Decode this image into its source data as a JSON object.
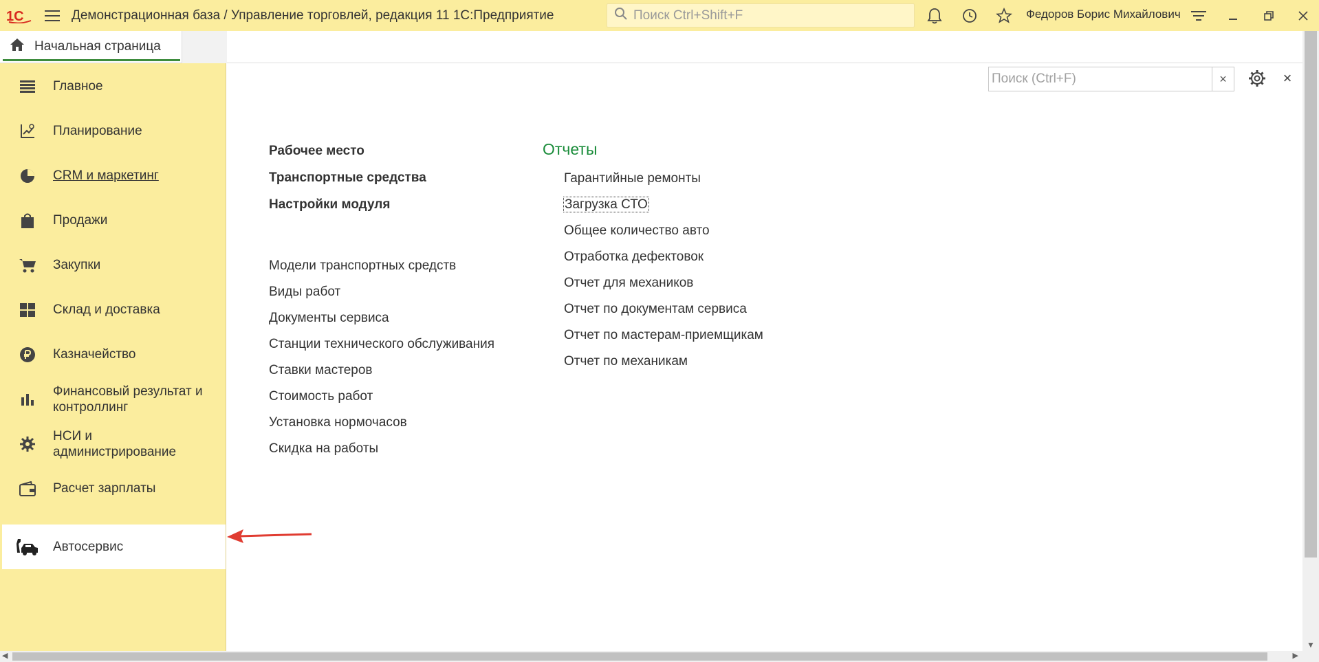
{
  "titlebar": {
    "app_title": "Демонстрационная база / Управление торговлей, редакция 11 1С:Предприятие",
    "search_placeholder": "Поиск Ctrl+Shift+F",
    "user_name": "Федоров Борис Михайлович"
  },
  "tabs": {
    "home_label": "Начальная страница"
  },
  "sidebar": {
    "items": [
      {
        "label": "Главное",
        "icon": "list-icon"
      },
      {
        "label": "Планирование",
        "icon": "planning-chart-icon"
      },
      {
        "label": "CRM и маркетинг",
        "icon": "pie-chart-icon"
      },
      {
        "label": "Продажи",
        "icon": "shopping-bag-icon"
      },
      {
        "label": "Закупки",
        "icon": "cart-icon"
      },
      {
        "label": "Склад и доставка",
        "icon": "warehouse-grid-icon"
      },
      {
        "label": "Казначейство",
        "icon": "ruble-coin-icon"
      },
      {
        "label": "Финансовый результат и контроллинг",
        "icon": "bar-chart-icon"
      },
      {
        "label": "НСИ и администрирование",
        "icon": "gear-icon"
      },
      {
        "label": "Расчет зарплаты",
        "icon": "wallet-icon"
      },
      {
        "label": "Автосервис",
        "icon": "car-service-icon"
      }
    ]
  },
  "panel": {
    "search_placeholder": "Поиск (Ctrl+F)",
    "clear_label": "×",
    "close_label": "×",
    "primary_links": [
      "Рабочее место",
      "Транспортные средства",
      "Настройки модуля"
    ],
    "secondary_links": [
      "Модели транспортных средств",
      "Виды работ",
      "Документы сервиса",
      "Станции технического обслуживания",
      "Ставки мастеров",
      "Стоимость работ",
      "Установка нормочасов",
      "Скидка на работы"
    ],
    "reports_title": "Отчеты",
    "reports": [
      "Гарантийные ремонты",
      "Загрузка СТО",
      "Общее количество авто",
      "Отработка дефектовок",
      "Отчет для механиков",
      "Отчет по документам сервиса",
      "Отчет по мастерам-приемщикам",
      "Отчет по механикам"
    ]
  },
  "colors": {
    "sidebar_bg": "#fbed9e",
    "accent_green": "#1a8c3a",
    "annotation_red": "#e03c31"
  }
}
